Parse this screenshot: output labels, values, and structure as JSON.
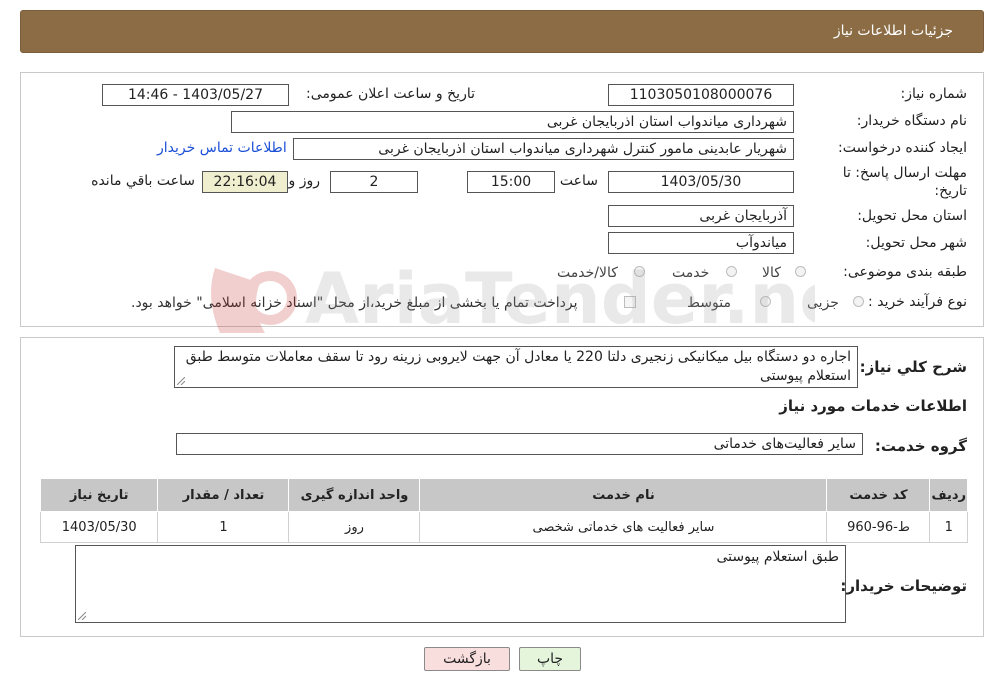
{
  "header": {
    "title": "جزئیات اطلاعات نیاز"
  },
  "form": {
    "need_number_label": "شماره نیاز:",
    "need_number": "1103050108000076",
    "announce_label": "تاریخ و ساعت اعلان عمومی:",
    "announce_value": "1403/05/27 - 14:46",
    "buyer_org_label": "نام دستگاه خریدار:",
    "buyer_org": "شهرداری میاندواب استان اذربایجان غربی",
    "creator_label": "ایجاد کننده درخواست:",
    "creator": "شهریار  عابدینی مامور کنترل شهرداری میاندواب استان اذربایجان غربی",
    "contact_link": "اطلاعات تماس خریدار",
    "deadline_label_1": "مهلت ارسال پاسخ: تا",
    "deadline_label_2": "تاریخ:",
    "deadline_date": "1403/05/30",
    "time_label": "ساعت",
    "deadline_time": "15:00",
    "days_value": "2",
    "days_label": "روز و",
    "remaining_time": "22:16:04",
    "remaining_label": "ساعت باقي مانده",
    "province_label": "استان محل تحویل:",
    "province": "آذربایجان غربی",
    "city_label": "شهر محل تحویل:",
    "city": "میاندوآب",
    "category_label": "طبقه بندی موضوعی:",
    "category_options": [
      "کالا",
      "خدمت",
      "کالا/خدمت"
    ],
    "process_label": "نوع فرآیند خرید :",
    "process_options": [
      "جزیی",
      "متوسط"
    ],
    "payment_note": "پرداخت تمام یا بخشی از مبلغ خرید،از محل \"اسناد خزانه اسلامی\" خواهد بود."
  },
  "details": {
    "description_label": "شرح کلي نياز:",
    "description": "اجاره دو دستگاه بیل میکانیکی زنجیری دلتا 220 یا معادل آن جهت لایروبی زرینه رود تا سقف معاملات متوسط طبق استعلام پیوستی",
    "services_title": "اطلاعات خدمات مورد نياز",
    "service_group_label": "گروه خدمت:",
    "service_group": "سایر فعالیت‌های خدماتی",
    "table": {
      "headers": [
        "ردیف",
        "کد خدمت",
        "نام خدمت",
        "واحد اندازه گیری",
        "تعداد / مقدار",
        "تاریخ نیاز"
      ],
      "rows": [
        [
          "1",
          "ط-96-960",
          "سایر فعالیت های خدماتی شخصی",
          "روز",
          "1",
          "1403/05/30"
        ]
      ]
    },
    "buyer_notes_label": "توضیحات خریدار:",
    "buyer_notes": "طبق استعلام پیوستی"
  },
  "buttons": {
    "print": "چاپ",
    "back": "بازگشت"
  },
  "watermark": {
    "text": "AriaTender.neT"
  }
}
